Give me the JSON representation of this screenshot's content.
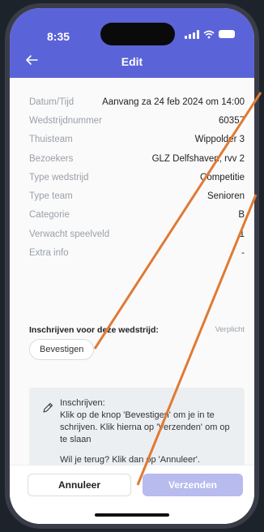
{
  "status_bar": {
    "time": "8:35"
  },
  "header": {
    "title": "Edit"
  },
  "details": [
    {
      "label": "Datum/Tijd",
      "value": "Aanvang za 24 feb 2024 om 14:00"
    },
    {
      "label": "Wedstrijdnummer",
      "value": "60357"
    },
    {
      "label": "Thuisteam",
      "value": "Wippolder 3"
    },
    {
      "label": "Bezoekers",
      "value": "GLZ Delfshaven, rvv 2"
    },
    {
      "label": "Type wedstrijd",
      "value": "Competitie"
    },
    {
      "label": "Type team",
      "value": "Senioren"
    },
    {
      "label": "Categorie",
      "value": "B"
    },
    {
      "label": "Verwacht speelveld",
      "value": "1"
    },
    {
      "label": "Extra info",
      "value": "-"
    }
  ],
  "signup": {
    "label": "Inschrijven voor deze wedstrijd:",
    "required": "Verplicht",
    "confirm_button": "Bevestigen"
  },
  "info": {
    "title": "Inschrijven:",
    "text": "Klik op de knop 'Bevestigen' om je in te schrijven. Klik hierna op 'Verzenden' om op te slaan",
    "back_text": "Wil je terug? Klik dan op 'Annuleer'."
  },
  "footer": {
    "cancel_button": "Annuleer",
    "send_button": "Verzenden"
  },
  "colors": {
    "header": "#5b63d9",
    "send_disabled": "#b8bbee",
    "annotation_arrow": "#e07a34"
  },
  "icons": [
    "back-arrow-icon",
    "pencil-icon",
    "signal-icon",
    "wifi-icon",
    "battery-icon"
  ]
}
